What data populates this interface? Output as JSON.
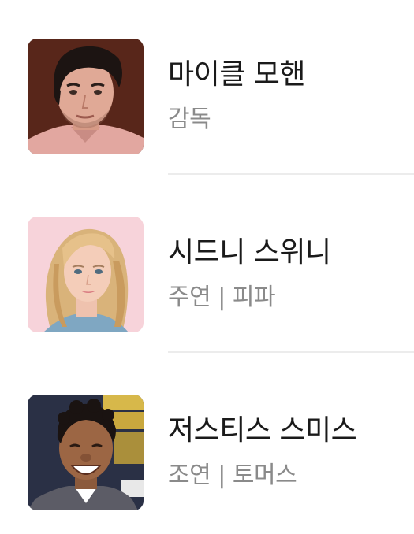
{
  "cast": [
    {
      "name": "마이클 모핸",
      "role": "감독",
      "photo": "director-portrait",
      "bg_color": "#5a2a1e"
    },
    {
      "name": "시드니 스위니",
      "role": "주연 | 피파",
      "photo": "lead-actress-portrait",
      "bg_color": "#f6cfd6"
    },
    {
      "name": "저스티스 스미스",
      "role": "조연 | 토머스",
      "photo": "supporting-actor-portrait",
      "bg_color": "#2c3347"
    }
  ]
}
